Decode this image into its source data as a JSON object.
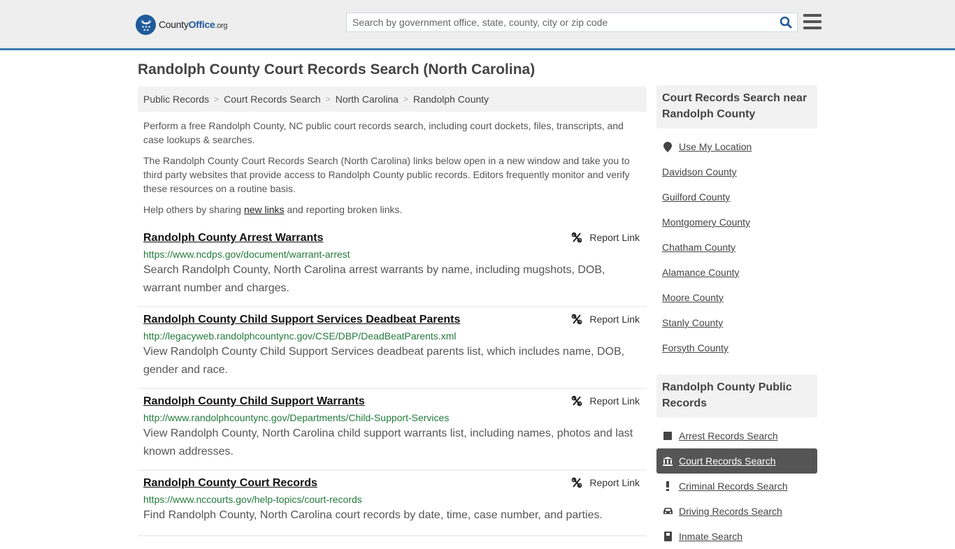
{
  "header": {
    "logo": {
      "brand_prefix": "County",
      "brand_main": "Office",
      "brand_tld": ".org"
    },
    "search": {
      "placeholder": "Search by government office, state, county, city or zip code",
      "value": ""
    },
    "colors": {
      "brand_blue": "#1f5a99",
      "accent_bar": "#3a7cad"
    }
  },
  "page": {
    "title": "Randolph County Court Records Search (North Carolina)"
  },
  "breadcrumb": [
    {
      "label": "Public Records"
    },
    {
      "label": "Court Records Search"
    },
    {
      "label": "North Carolina"
    },
    {
      "label": "Randolph County"
    }
  ],
  "intro": {
    "p1": "Perform a free Randolph County, NC public court records search, including court dockets, files, transcripts, and case lookups & searches.",
    "p2": "The Randolph County Court Records Search (North Carolina) links below open in a new window and take you to third party websites that provide access to Randolph County public records. Editors frequently monitor and verify these resources on a routine basis.",
    "p3_before": "Help others by sharing ",
    "p3_link": "new links",
    "p3_after": " and reporting broken links."
  },
  "results": [
    {
      "title": "Randolph County Arrest Warrants",
      "url": "https://www.ncdps.gov/document/warrant-arrest",
      "description": "Search Randolph County, North Carolina arrest warrants by name, including mugshots, DOB, warrant number and charges.",
      "report_label": "Report Link"
    },
    {
      "title": "Randolph County Child Support Services Deadbeat Parents",
      "url": "http://legacyweb.randolphcountync.gov/CSE/DBP/DeadBeatParents.xml",
      "description": "View Randolph County Child Support Services deadbeat parents list, which includes name, DOB, gender and race.",
      "report_label": "Report Link"
    },
    {
      "title": "Randolph County Child Support Warrants",
      "url": "http://www.randolphcountync.gov/Departments/Child-Support-Services",
      "description": "View Randolph County, North Carolina child support warrants list, including names, photos and last known addresses.",
      "report_label": "Report Link"
    },
    {
      "title": "Randolph County Court Records",
      "url": "https://www.nccourts.gov/help-topics/court-records",
      "description": "Find Randolph County, North Carolina court records by date, time, case number, and parties.",
      "report_label": "Report Link"
    }
  ],
  "sidebar": {
    "nearby": {
      "heading": "Court Records Search near Randolph County",
      "use_location": "Use My Location",
      "counties": [
        "Davidson County",
        "Guilford County",
        "Montgomery County",
        "Chatham County",
        "Alamance County",
        "Moore County",
        "Stanly County",
        "Forsyth County"
      ]
    },
    "public_records": {
      "heading": "Randolph County Public Records",
      "items": [
        {
          "label": "Arrest Records Search",
          "icon": "square-icon",
          "active": false
        },
        {
          "label": "Court Records Search",
          "icon": "courthouse-icon",
          "active": true
        },
        {
          "label": "Criminal Records Search",
          "icon": "exclamation-icon",
          "active": false
        },
        {
          "label": "Driving Records Search",
          "icon": "car-icon",
          "active": false
        },
        {
          "label": "Inmate Search",
          "icon": "inmate-icon",
          "active": false
        }
      ]
    }
  }
}
